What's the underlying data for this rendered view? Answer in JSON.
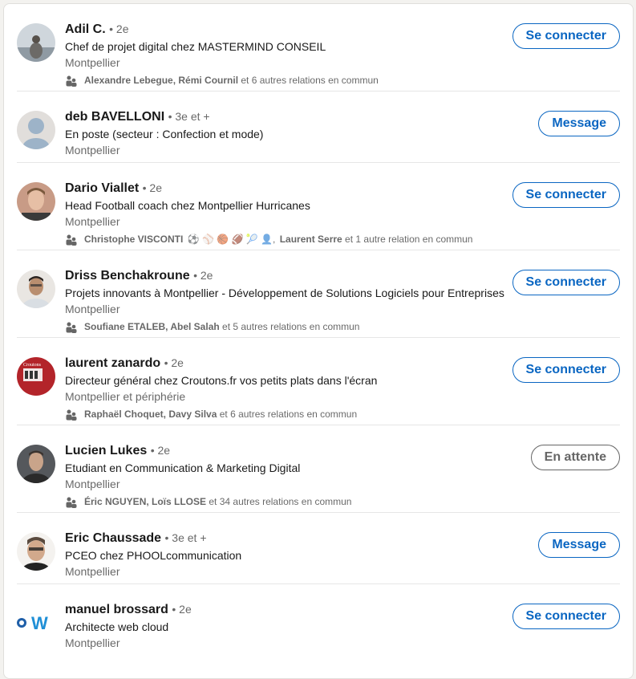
{
  "people": [
    {
      "name": "Adil C.",
      "degree": "• 2e",
      "headline": "Chef de projet digital chez MASTERMIND CONSEIL",
      "location": "Montpellier",
      "mutual_names": "Alexandre Lebegue, Rémi Cournil",
      "mutual_rest": " et 6 autres relations en commun",
      "action": "Se connecter",
      "avatar_color": "#9aa7b3"
    },
    {
      "name": "deb BAVELLONI",
      "degree": "• 3e et +",
      "headline": "En poste (secteur : Confection et mode)",
      "location": "Montpellier",
      "action": "Message",
      "avatar_color": "#d6d3d0"
    },
    {
      "name": "Dario Viallet",
      "degree": "• 2e",
      "headline": "Head Football coach chez Montpellier Hurricanes",
      "location": "Montpellier",
      "mutual_names": "Christophe VISCONTI",
      "mutual_emoji": "⚽ ⚾ 🏀 🏈 🎾 👤,",
      "mutual_names2": "Laurent Serre",
      "mutual_rest": " et 1 autre relation en commun",
      "action": "Se connecter",
      "avatar_color": "#b48a74"
    },
    {
      "name": "Driss Benchakroune",
      "degree": "• 2e",
      "headline": "Projets innovants à Montpellier - Développement de Solutions Logiciels pour Entreprises",
      "location": "Montpellier",
      "mutual_names": "Soufiane ETALEB, Abel Salah",
      "mutual_rest": " et 5 autres relations en commun",
      "action": "Se connecter",
      "avatar_color": "#c9bdb2"
    },
    {
      "name": "laurent zanardo",
      "degree": "• 2e",
      "headline": "Directeur général chez Croutons.fr vos petits plats dans l'écran",
      "location": "Montpellier et périphérie",
      "mutual_names": "Raphaël Choquet, Davy Silva",
      "mutual_rest": " et 6 autres relations en commun",
      "action": "Se connecter",
      "avatar_color": "#b3242a"
    },
    {
      "name": "Lucien Lukes",
      "degree": "• 2e",
      "headline": "Etudiant en Communication & Marketing Digital",
      "location": "Montpellier",
      "mutual_names": "Éric NGUYEN, Loïs LLOSE",
      "mutual_rest": " et 34 autres relations en commun",
      "action": "En attente",
      "avatar_color": "#4d4f52"
    },
    {
      "name": "Eric Chaussade",
      "degree": "• 3e et +",
      "headline": "PCEO chez PHOOLcommunication",
      "location": "Montpellier",
      "action": "Message",
      "avatar_color": "#c7a48a"
    },
    {
      "name": "manuel brossard",
      "degree": "• 2e",
      "headline": "Architecte web cloud",
      "location": "Montpellier",
      "action": "Se connecter",
      "avatar_color": "#1f5fa8"
    }
  ]
}
